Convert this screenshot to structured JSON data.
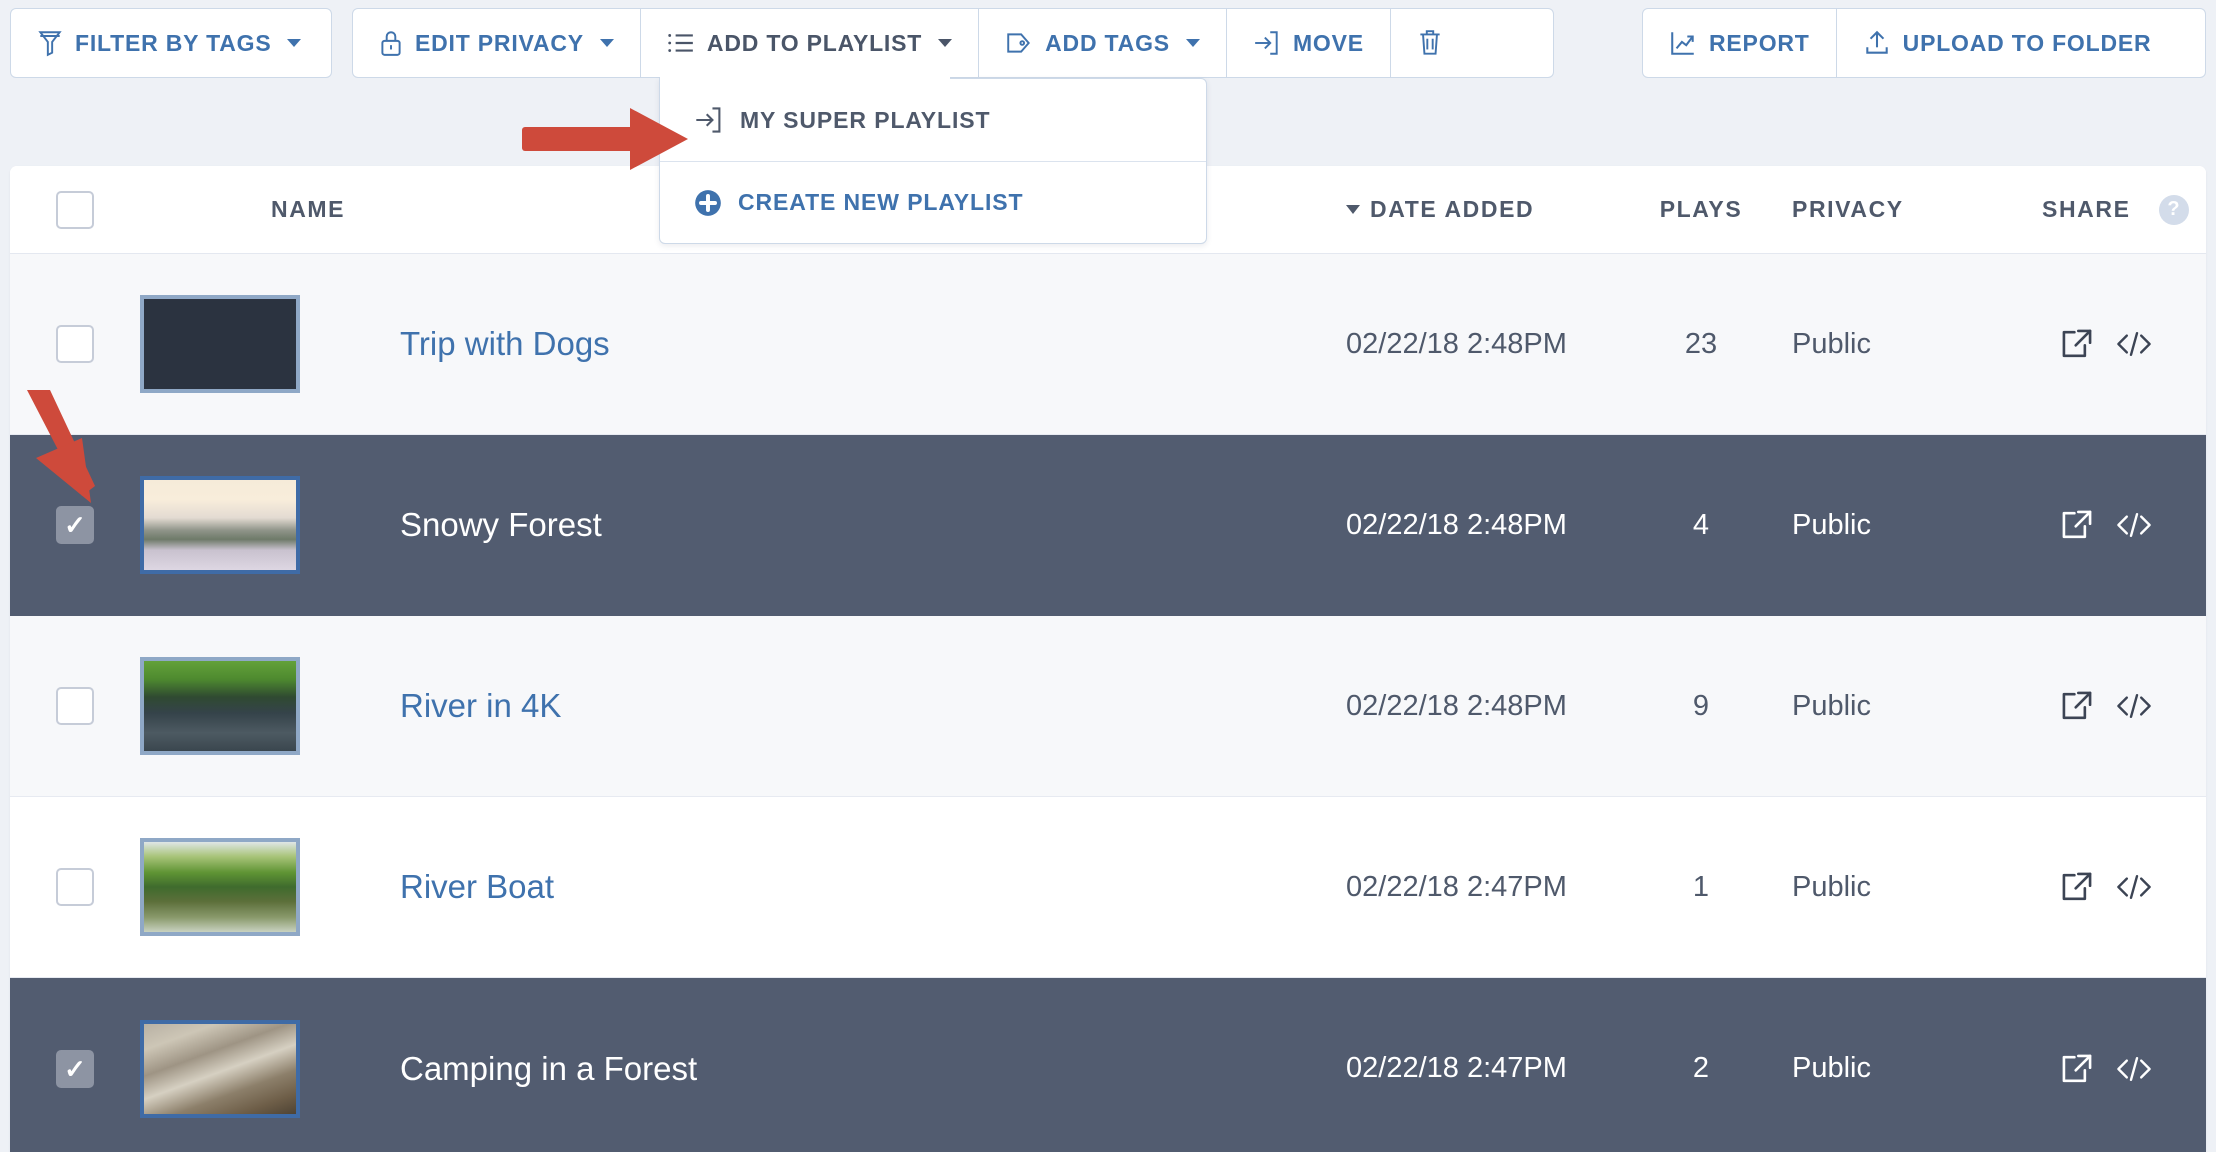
{
  "theme": {
    "accent_blue": "#3f72ad",
    "selected_row": "#525c70",
    "annotation_red": "#ce4a3b",
    "page_bg": "#eef1f6",
    "border": "#cdd9e8"
  },
  "toolbar": {
    "groups": [
      {
        "id": "left",
        "buttons": [
          {
            "label": "Filter by Tags",
            "icon": "funnel-icon",
            "caret": true,
            "active": false
          }
        ]
      },
      {
        "id": "mid",
        "buttons": [
          {
            "label": "Edit Privacy",
            "icon": "lock-icon",
            "caret": true,
            "active": false
          },
          {
            "label": "Add to Playlist",
            "icon": "list-icon",
            "caret": true,
            "active": true
          },
          {
            "label": "Add Tags",
            "icon": "tag-icon",
            "caret": true,
            "active": false
          },
          {
            "label": "Move",
            "icon": "move-icon",
            "caret": false,
            "active": false
          },
          {
            "label": "",
            "icon": "trash-icon",
            "caret": false,
            "active": false
          }
        ]
      },
      {
        "id": "right",
        "buttons": [
          {
            "label": "Report",
            "icon": "chart-icon",
            "caret": false,
            "active": false
          },
          {
            "label": "Upload to Folder",
            "icon": "upload-icon",
            "caret": false,
            "active": false
          }
        ]
      }
    ]
  },
  "dropdown": {
    "open_for": "Add to Playlist",
    "items": [
      {
        "label": "My Super Playlist",
        "icon": "move-icon",
        "style": "plain"
      },
      {
        "label": "Create New Playlist",
        "icon": "plus-circle-icon",
        "style": "create"
      }
    ]
  },
  "table": {
    "select_all_checked": false,
    "columns": [
      {
        "key": "check",
        "label": ""
      },
      {
        "key": "thumb",
        "label": ""
      },
      {
        "key": "name",
        "label": "Name"
      },
      {
        "key": "date",
        "label": "Date Added",
        "sorted": true,
        "sort_dir": "desc"
      },
      {
        "key": "plays",
        "label": "Plays"
      },
      {
        "key": "privacy",
        "label": "Privacy"
      },
      {
        "key": "share",
        "label": "Share",
        "help": "?"
      }
    ],
    "rows": [
      {
        "name": "Trip with Dogs",
        "date": "02/22/18 2:48PM",
        "plays": "23",
        "privacy": "Public",
        "selected": false,
        "checked": false,
        "thumb": "forest-canopy"
      },
      {
        "name": "Snowy Forest",
        "date": "02/22/18 2:48PM",
        "plays": "4",
        "privacy": "Public",
        "selected": true,
        "checked": true,
        "thumb": "snowy-sunset"
      },
      {
        "name": "River in 4K",
        "date": "02/22/18 2:48PM",
        "plays": "9",
        "privacy": "Public",
        "selected": false,
        "checked": false,
        "thumb": "green-river"
      },
      {
        "name": "River Boat",
        "date": "02/22/18 2:47PM",
        "plays": "1",
        "privacy": "Public",
        "selected": false,
        "checked": false,
        "thumb": "river-bank"
      },
      {
        "name": "Camping in a Forest",
        "date": "02/22/18 2:47PM",
        "plays": "2",
        "privacy": "Public",
        "selected": true,
        "checked": true,
        "thumb": "driftwood"
      }
    ],
    "row_share_icons": [
      "share-export-icon",
      "embed-code-icon"
    ]
  },
  "annotations": [
    {
      "id": "arrow-right",
      "shape": "right-arrow",
      "points_at": "My Super Playlist"
    },
    {
      "id": "arrow-down",
      "shape": "diagonal-down-arrow",
      "points_at": "Snowy Forest row checkbox"
    }
  ]
}
